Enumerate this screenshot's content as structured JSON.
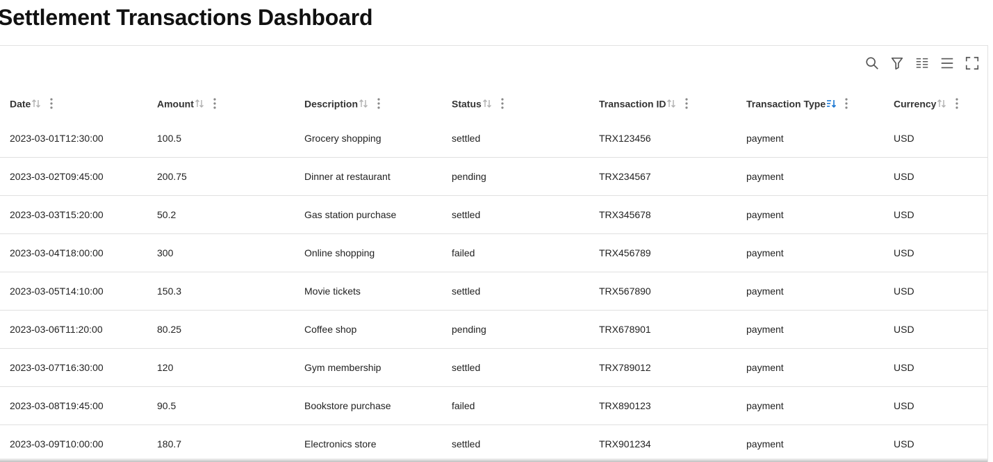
{
  "page": {
    "title": "Settlement Transactions Dashboard"
  },
  "toolbar": {
    "icons": [
      "search-icon",
      "filter-icon",
      "columns-icon",
      "density-icon",
      "fullscreen-icon"
    ]
  },
  "colors": {
    "sort_active": "#1976d2",
    "sort_inactive": "#b0b0b0",
    "border": "#e0e0e0"
  },
  "table": {
    "columns": [
      {
        "label": "Date",
        "sort": "none"
      },
      {
        "label": "Amount",
        "sort": "none"
      },
      {
        "label": "Description",
        "sort": "none"
      },
      {
        "label": "Status",
        "sort": "none"
      },
      {
        "label": "Transaction ID",
        "sort": "none"
      },
      {
        "label": "Transaction Type",
        "sort": "active"
      },
      {
        "label": "Currency",
        "sort": "none"
      }
    ],
    "rows": [
      [
        "2023-03-01T12:30:00",
        "100.5",
        "Grocery shopping",
        "settled",
        "TRX123456",
        "payment",
        "USD"
      ],
      [
        "2023-03-02T09:45:00",
        "200.75",
        "Dinner at restaurant",
        "pending",
        "TRX234567",
        "payment",
        "USD"
      ],
      [
        "2023-03-03T15:20:00",
        "50.2",
        "Gas station purchase",
        "settled",
        "TRX345678",
        "payment",
        "USD"
      ],
      [
        "2023-03-04T18:00:00",
        "300",
        "Online shopping",
        "failed",
        "TRX456789",
        "payment",
        "USD"
      ],
      [
        "2023-03-05T14:10:00",
        "150.3",
        "Movie tickets",
        "settled",
        "TRX567890",
        "payment",
        "USD"
      ],
      [
        "2023-03-06T11:20:00",
        "80.25",
        "Coffee shop",
        "pending",
        "TRX678901",
        "payment",
        "USD"
      ],
      [
        "2023-03-07T16:30:00",
        "120",
        "Gym membership",
        "settled",
        "TRX789012",
        "payment",
        "USD"
      ],
      [
        "2023-03-08T19:45:00",
        "90.5",
        "Bookstore purchase",
        "failed",
        "TRX890123",
        "payment",
        "USD"
      ],
      [
        "2023-03-09T10:00:00",
        "180.7",
        "Electronics store",
        "settled",
        "TRX901234",
        "payment",
        "USD"
      ]
    ]
  }
}
